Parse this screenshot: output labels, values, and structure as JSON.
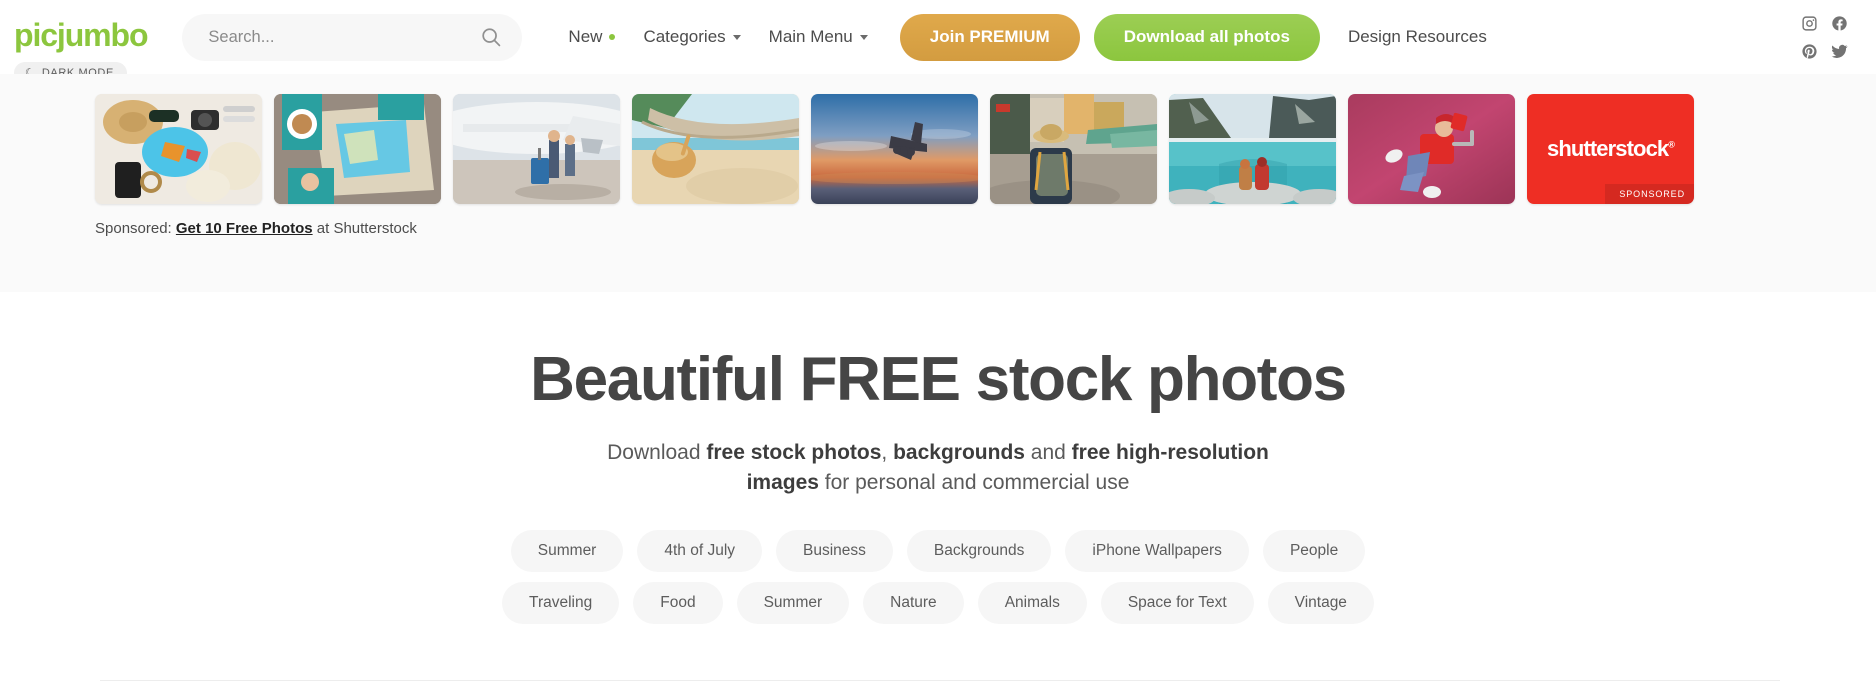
{
  "header": {
    "logo": "picjumbo",
    "search": {
      "value": "",
      "placeholder": "Search...",
      "icon": "search-icon"
    },
    "nav": [
      {
        "label": "New",
        "type": "dot"
      },
      {
        "label": "Categories",
        "type": "caret"
      },
      {
        "label": "Main Menu",
        "type": "caret"
      }
    ],
    "premium_button": "Join PREMIUM",
    "download_button": "Download all photos",
    "design_resources": "Design Resources",
    "socials": [
      {
        "name": "instagram-icon"
      },
      {
        "name": "facebook-icon"
      },
      {
        "name": "pinterest-icon"
      },
      {
        "name": "twitter-icon"
      }
    ],
    "colors": {
      "brand_green": "#8cc63e",
      "premium_orange": "#d39c40",
      "shutterstock_red": "#ee2e24"
    }
  },
  "dark_mode": {
    "label": "DARK MODE",
    "icon": "moon-icon",
    "glyph": "☾"
  },
  "sponsored_strip": {
    "thumbnails": [
      {
        "alt": "flat-lay travel items with hat sunglasses camera and map"
      },
      {
        "alt": "person reading paper map with coffee on wooden table"
      },
      {
        "alt": "travellers with suitcase walking toward airplane"
      },
      {
        "alt": "woman relaxing in hammock on tropical beach"
      },
      {
        "alt": "airplane flying over ocean at sunset"
      },
      {
        "alt": "backpacker with straw hat in busy street market"
      },
      {
        "alt": "two people with backpacks sitting by mountain lake"
      },
      {
        "alt": "woman running with red suitcase on pink background"
      }
    ],
    "ad_card": {
      "logo": "shutterstock",
      "trademark": "®",
      "badge": "SPONSORED"
    },
    "caption": {
      "prefix": "Sponsored: ",
      "link": "Get 10 Free Photos",
      "suffix": " at Shutterstock"
    }
  },
  "hero": {
    "title": "Beautiful FREE stock photos",
    "subtitle": {
      "part1": "Download ",
      "bold1": "free stock photos",
      "part2": ", ",
      "bold2": "backgrounds",
      "part3": " and ",
      "bold3": "free high-resolution images",
      "part4": " for personal and commercial use"
    },
    "tags_row1": [
      "Summer",
      "4th of July",
      "Business",
      "Backgrounds",
      "iPhone Wallpapers",
      "People"
    ],
    "tags_row2": [
      "Traveling",
      "Food",
      "Summer",
      "Nature",
      "Animals",
      "Space for Text",
      "Vintage"
    ]
  }
}
